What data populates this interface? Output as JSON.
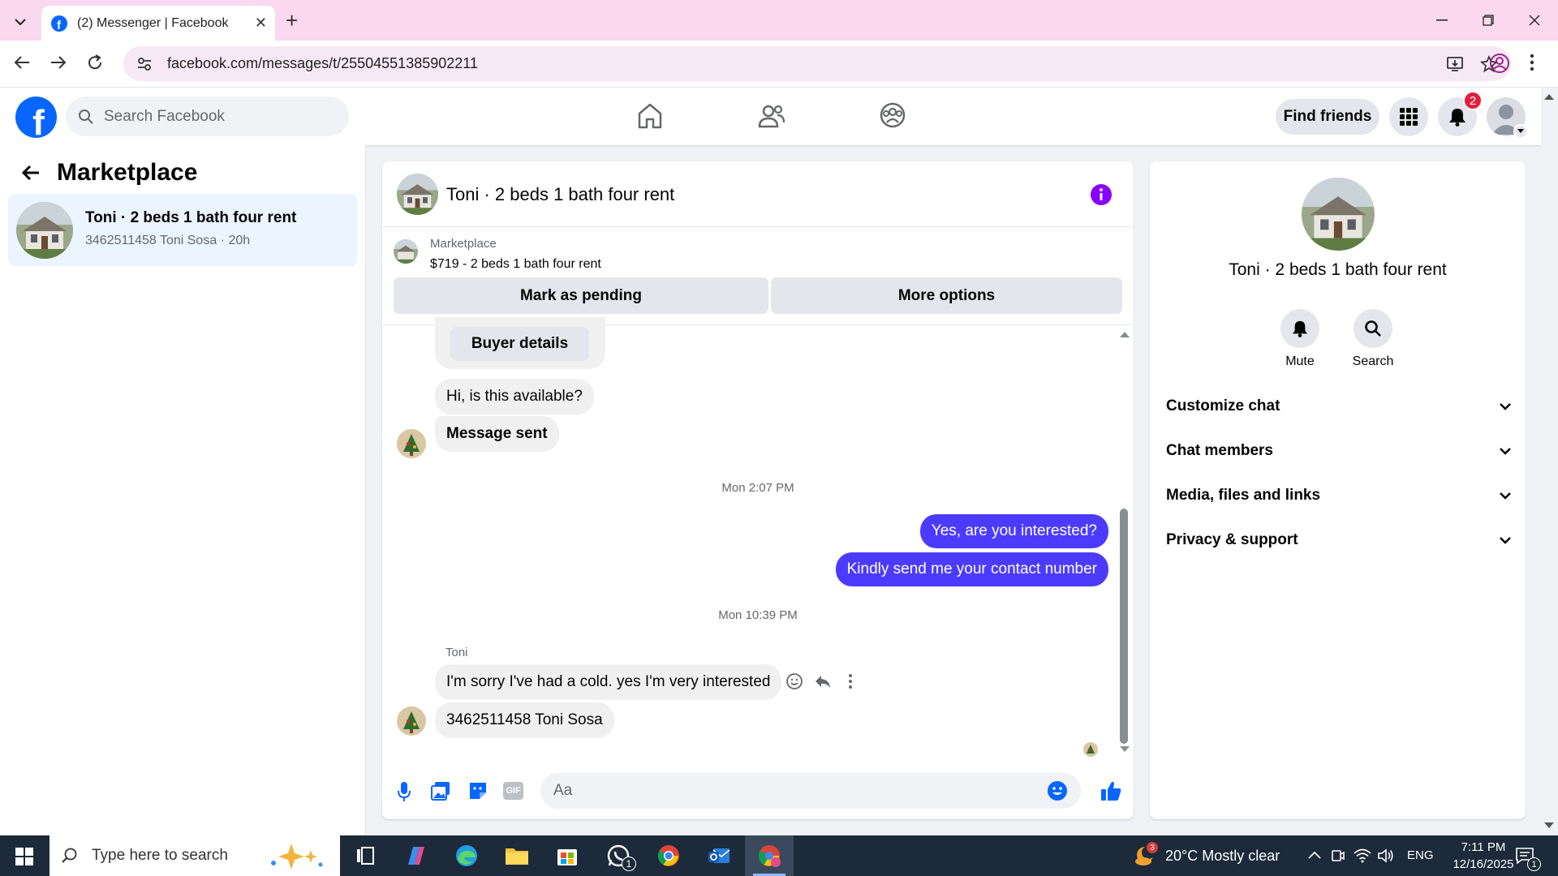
{
  "browser": {
    "tab_title": "(2) Messenger | Facebook",
    "url": "facebook.com/messages/t/25504551385902211"
  },
  "header": {
    "search_placeholder": "Search Facebook",
    "find_friends": "Find friends",
    "notification_count": "2"
  },
  "left": {
    "title": "Marketplace",
    "conversation": {
      "name": "Toni · 2 beds 1 bath four rent",
      "subtitle": "3462511458 Toni Sosa · 20h"
    }
  },
  "chat": {
    "title": "Toni · 2 beds 1 bath four rent",
    "marketplace_label": "Marketplace",
    "listing": "$719 - 2 beds 1 bath four rent",
    "mark_pending": "Mark as pending",
    "more_options": "More options",
    "buyer_details": "Buyer details",
    "messages": {
      "m1": "Hi, is this available?",
      "m2": "Message sent",
      "ts1": "Mon 2:07 PM",
      "m3": "Yes, are you interested?",
      "m4": "Kindly send me your contact number",
      "ts2": "Mon 10:39 PM",
      "sender": "Toni",
      "m5": "I'm sorry I've had a cold. yes I'm very interested",
      "m6": "3462511458 Toni Sosa"
    },
    "composer_placeholder": "Aa"
  },
  "right": {
    "name": "Toni · 2 beds 1 bath four rent",
    "mute": "Mute",
    "search": "Search",
    "sections": [
      "Customize chat",
      "Chat members",
      "Media, files and links",
      "Privacy & support"
    ]
  },
  "taskbar": {
    "search_placeholder": "Type here to search",
    "weather": "20°C  Mostly clear",
    "weather_badge": "3",
    "lang": "ENG",
    "time": "7:11 PM",
    "date": "12/16/2025",
    "whatsapp_badge": "1",
    "notif_badge": "1"
  },
  "colors": {
    "fb_blue": "#0866ff",
    "outgoing": "#4c3bff",
    "info_purple": "#8a00ff"
  }
}
